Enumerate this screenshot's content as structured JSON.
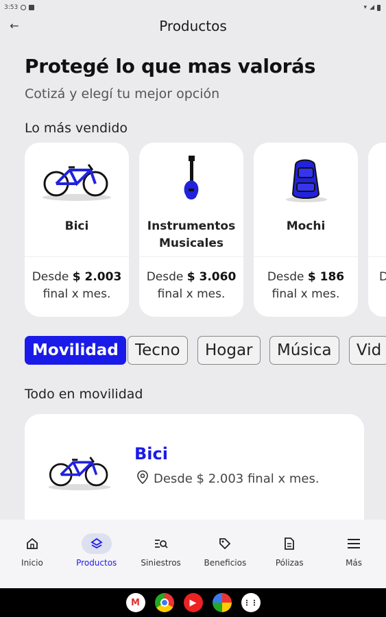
{
  "statusbar": {
    "time": "3:53"
  },
  "appbar": {
    "title": "Productos"
  },
  "hero": {
    "title": "Protegé lo que mas valorás",
    "subtitle": "Cotizá y elegí tu mejor opción"
  },
  "bestsellers": {
    "title": "Lo más vendido",
    "cards": [
      {
        "name": "Bici",
        "from": "Desde",
        "price": "$ 2.003",
        "period": "final x mes."
      },
      {
        "name": "Instrumentos Musicales",
        "from": "Desde",
        "price": "$ 3.060",
        "period": "final x mes."
      },
      {
        "name": "Mochi",
        "from": "Desde",
        "price": "$ 186",
        "period": "final x mes."
      }
    ]
  },
  "categories": [
    "Movilidad",
    "Tecno",
    "Hogar",
    "Música",
    "Vid"
  ],
  "mobility": {
    "title": "Todo en movilidad",
    "item": {
      "name": "Bici",
      "price_text": "Desde $ 2.003 final x mes."
    }
  },
  "nav": {
    "items": [
      {
        "label": "Inicio",
        "icon": "home-icon"
      },
      {
        "label": "Productos",
        "icon": "layers-icon"
      },
      {
        "label": "Siniestros",
        "icon": "search-list-icon"
      },
      {
        "label": "Beneficios",
        "icon": "tag-icon"
      },
      {
        "label": "Pólizas",
        "icon": "document-icon"
      },
      {
        "label": "Más",
        "icon": "menu-icon"
      }
    ]
  },
  "colors": {
    "accent": "#1a1be8",
    "background": "#ebeaed"
  }
}
